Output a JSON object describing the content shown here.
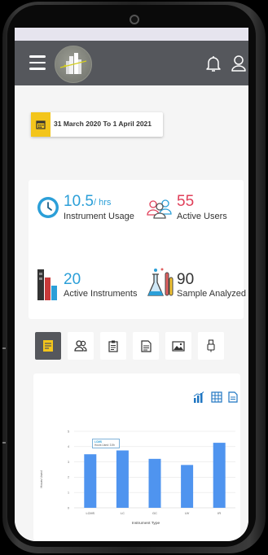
{
  "header": {
    "menu_icon": "hamburger-menu-icon",
    "logo_icon": "building-logo-icon",
    "notification_icon": "bell-icon",
    "profile_icon": "user-icon"
  },
  "date_range": {
    "icon": "calendar-icon",
    "text": "31 March 2020 To 1 April 2021"
  },
  "stats": {
    "instrument_usage": {
      "value": "10.5",
      "unit": "/ hrs",
      "label": "Instrument Usage",
      "icon": "clock-icon",
      "color": "#2b9fd8"
    },
    "active_users": {
      "value": "55",
      "label": "Active Users",
      "icon": "users-icon",
      "color": "#e0405a"
    },
    "active_instruments": {
      "value": "20",
      "label": "Active Instruments",
      "icon": "instrument-chart-icon",
      "color": "#2b9fd8"
    },
    "sample_analyzed": {
      "value": "90",
      "label": "Sample Analyzed",
      "icon": "lab-flask-icon",
      "color": "#333333"
    }
  },
  "tabs": [
    {
      "icon": "document-chart-icon",
      "active": true
    },
    {
      "icon": "users-icon",
      "active": false
    },
    {
      "icon": "clipboard-list-icon",
      "active": false
    },
    {
      "icon": "report-file-icon",
      "active": false
    },
    {
      "icon": "image-gallery-icon",
      "active": false
    },
    {
      "icon": "usb-device-icon",
      "active": false
    }
  ],
  "chart_tools": [
    "bar-chart-icon",
    "table-icon",
    "document-icon"
  ],
  "chart_data": {
    "type": "bar",
    "categories": [
      "LCMS",
      "LC",
      "GC",
      "UV",
      "IR"
    ],
    "values": [
      3.5,
      3.75,
      3.2,
      2.8,
      4.25
    ],
    "ylim": [
      0,
      5
    ],
    "yticks": [
      0,
      1,
      2,
      3,
      4,
      5
    ],
    "xlabel": "Instrument Type",
    "ylabel": "Hours Used",
    "bar_color": "#4f94ef",
    "tooltip": {
      "title": "LCMS",
      "text": "Hours Used: 3.5h"
    }
  }
}
